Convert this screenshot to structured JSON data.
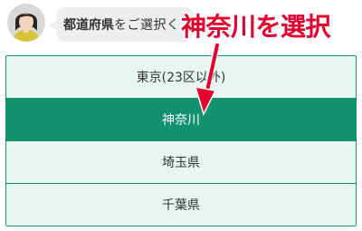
{
  "chat": {
    "prompt_bold": "都道府県",
    "prompt_rest": "をご選択く"
  },
  "annotation": {
    "text": "神奈川を選択",
    "color": "#e5002d"
  },
  "options": [
    {
      "label": "東京(23区以外)",
      "selected": false
    },
    {
      "label": "神奈川",
      "selected": true
    },
    {
      "label": "埼玉県",
      "selected": false
    },
    {
      "label": "千葉県",
      "selected": false
    }
  ],
  "colors": {
    "accent": "#11926d",
    "option_bg": "#e9f5f1",
    "bubble_bg": "#eeeeee"
  }
}
